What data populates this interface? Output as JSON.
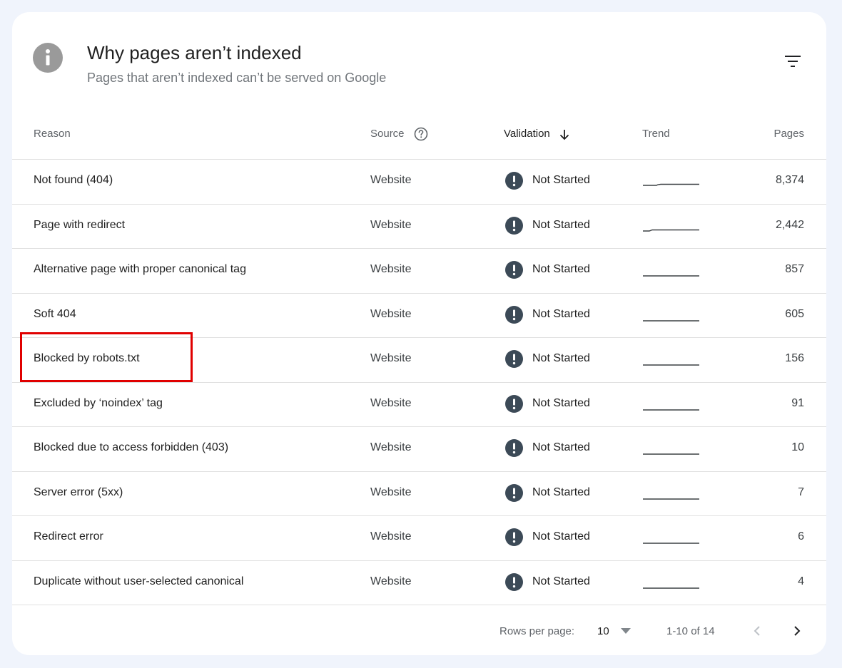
{
  "header": {
    "title": "Why pages aren’t indexed",
    "subtitle": "Pages that aren’t indexed can’t be served on Google"
  },
  "icons": {
    "header_icon": "info-icon",
    "filter": "filter-icon",
    "source_help": "help-circle-icon",
    "sort": "arrow-down-icon",
    "status": "exclamation-circle-icon",
    "prev": "chevron-left-icon",
    "next": "chevron-right-icon"
  },
  "columns": {
    "reason": "Reason",
    "source": "Source",
    "validation": "Validation",
    "trend": "Trend",
    "pages": "Pages"
  },
  "rows": [
    {
      "reason": "Not found (404)",
      "source": "Website",
      "validation": "Not Started",
      "pages": "8,374"
    },
    {
      "reason": "Page with redirect",
      "source": "Website",
      "validation": "Not Started",
      "pages": "2,442"
    },
    {
      "reason": "Alternative page with proper canonical tag",
      "source": "Website",
      "validation": "Not Started",
      "pages": "857"
    },
    {
      "reason": "Soft 404",
      "source": "Website",
      "validation": "Not Started",
      "pages": "605"
    },
    {
      "reason": "Blocked by robots.txt",
      "source": "Website",
      "validation": "Not Started",
      "pages": "156"
    },
    {
      "reason": "Excluded by ‘noindex’ tag",
      "source": "Website",
      "validation": "Not Started",
      "pages": "91"
    },
    {
      "reason": "Blocked due to access forbidden (403)",
      "source": "Website",
      "validation": "Not Started",
      "pages": "10"
    },
    {
      "reason": "Server error (5xx)",
      "source": "Website",
      "validation": "Not Started",
      "pages": "7"
    },
    {
      "reason": "Redirect error",
      "source": "Website",
      "validation": "Not Started",
      "pages": "6"
    },
    {
      "reason": "Duplicate without user-selected canonical",
      "source": "Website",
      "validation": "Not Started",
      "pages": "4"
    }
  ],
  "pagination": {
    "rows_per_page_label": "Rows per page:",
    "rows_per_page_value": "10",
    "range": "1-10 of 14"
  },
  "colors": {
    "highlight_border": "#e00000",
    "status_icon": "#3c4a57",
    "header_icon_bg": "#9a9a9a"
  }
}
